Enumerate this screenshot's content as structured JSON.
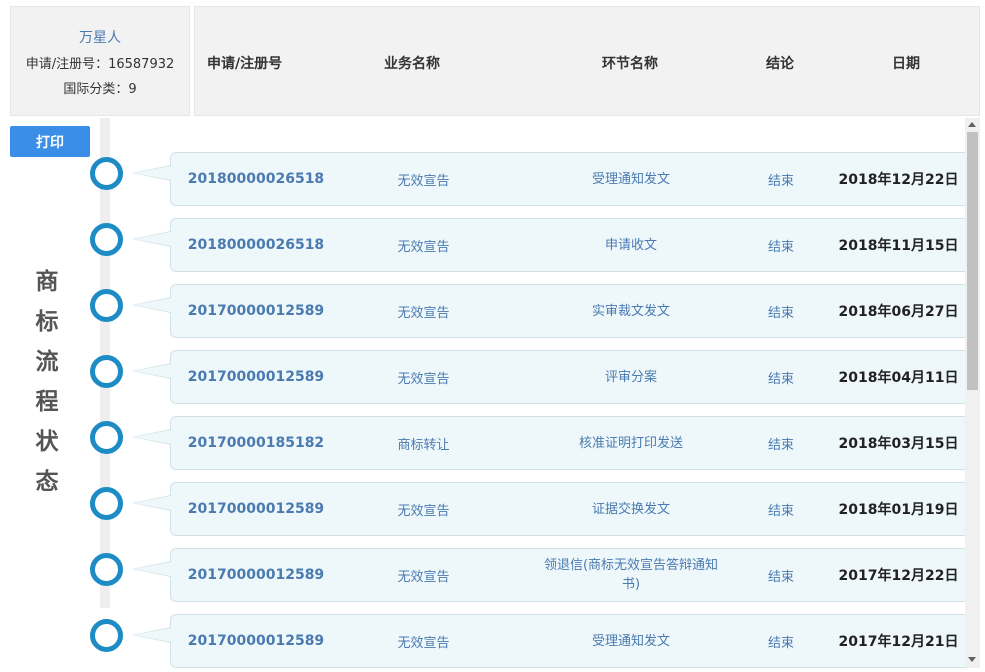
{
  "info": {
    "applicant": "万星人",
    "reg_no_line": "申请/注册号：16587932",
    "class_line": "国际分类：9"
  },
  "header": {
    "col_no": "申请/注册号",
    "col_biz": "业务名称",
    "col_step": "环节名称",
    "col_result": "结论",
    "col_date": "日期"
  },
  "print_label": "打印",
  "side_title": [
    "商",
    "标",
    "流",
    "程",
    "状",
    "态"
  ],
  "rows": [
    {
      "no": "20180000026518",
      "biz": "无效宣告",
      "step": "受理通知发文",
      "result": "结束",
      "date": "2018年12月22日"
    },
    {
      "no": "20180000026518",
      "biz": "无效宣告",
      "step": "申请收文",
      "result": "结束",
      "date": "2018年11月15日"
    },
    {
      "no": "20170000012589",
      "biz": "无效宣告",
      "step": "实审裁文发文",
      "result": "结束",
      "date": "2018年06月27日"
    },
    {
      "no": "20170000012589",
      "biz": "无效宣告",
      "step": "评审分案",
      "result": "结束",
      "date": "2018年04月11日"
    },
    {
      "no": "20170000185182",
      "biz": "商标转让",
      "step": "核准证明打印发送",
      "result": "结束",
      "date": "2018年03月15日"
    },
    {
      "no": "20170000012589",
      "biz": "无效宣告",
      "step": "证据交换发文",
      "result": "结束",
      "date": "2018年01月19日"
    },
    {
      "no": "20170000012589",
      "biz": "无效宣告",
      "step": "领退信(商标无效宣告答辩通知书)",
      "result": "结束",
      "date": "2017年12月22日"
    },
    {
      "no": "20170000012589",
      "biz": "无效宣告",
      "step": "受理通知发文",
      "result": "结束",
      "date": "2017年12月21日"
    }
  ],
  "colors": {
    "accent": "#1e8cc4",
    "button": "#3b8ee8",
    "link": "#4a7ab0"
  }
}
